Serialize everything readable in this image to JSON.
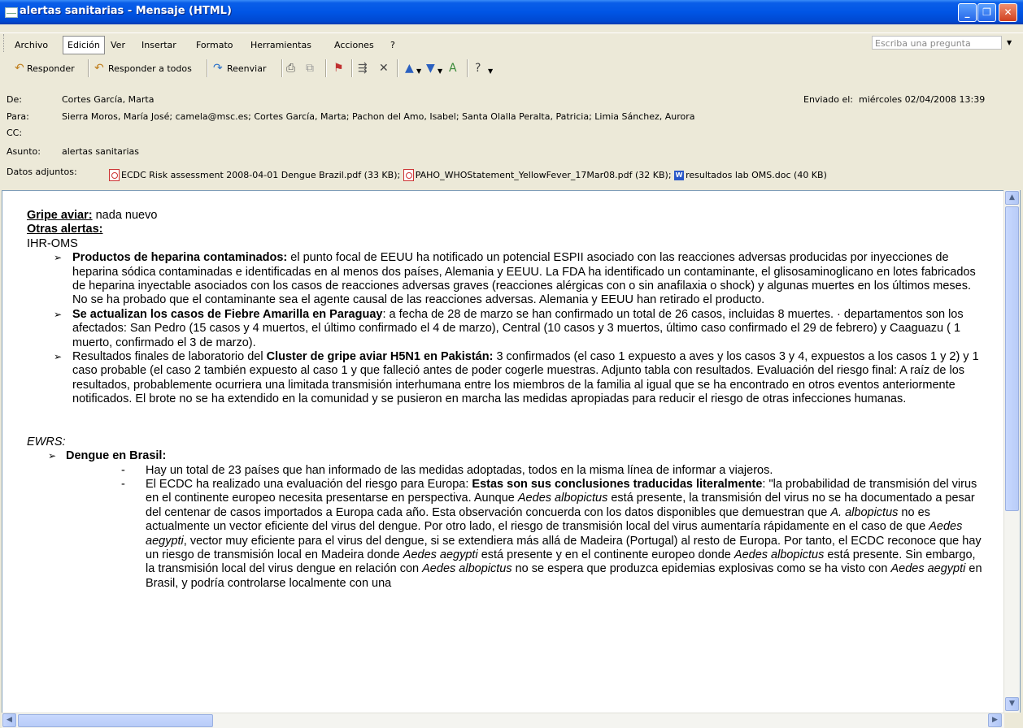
{
  "window": {
    "title": "alertas sanitarias - Mensaje (HTML)"
  },
  "menu": {
    "items": [
      "Archivo",
      "Edición",
      "Ver",
      "Insertar",
      "Formato",
      "Herramientas",
      "Acciones",
      "?"
    ],
    "active": "Edición",
    "ask_placeholder": "Escriba una pregunta"
  },
  "toolbar": {
    "reply": "Responder",
    "reply_all": "Responder a todos",
    "forward": "Reenviar"
  },
  "header": {
    "from_label": "De:",
    "from": "Cortes García, Marta",
    "to_label": "Para:",
    "to": "Sierra Moros, María José;  camela@msc.es; Cortes García, Marta; Pachon del Amo, Isabel; Santa Olalla Peralta, Patricia; Limia Sánchez, Aurora",
    "cc_label": "CC:",
    "subject_label": "Asunto:",
    "subject": "alertas sanitarias",
    "sent_label": "Enviado el:",
    "sent": "miércoles 02/04/2008 13:39",
    "attachments_label": "Datos adjuntos:",
    "attachments": [
      "ECDC Risk assessment 2008-04-01 Dengue Brazil.pdf (33 KB);",
      "PAHO_WHOStatement_YellowFever_17Mar08.pdf (32 KB);",
      "resultados lab OMS.doc (40 KB)"
    ]
  },
  "body": {
    "gripe_label": "Gripe aviar:",
    "gripe_text": " nada nuevo",
    "otras_label": "Otras alertas:",
    "ihr": "IHR-OMS",
    "b1_title": "Productos de heparina contaminados:",
    "b1_text": " el punto focal de EEUU ha notificado un potencial ESPII asociado con las reacciones adversas producidas por inyecciones de heparina sódica contaminadas e identificadas en al menos dos países, Alemania y EEUU. La FDA ha identificado un contaminante, el glisosaminoglicano en lotes fabricados de heparina inyectable asociados con los casos de reacciones adversas graves (reacciones alérgicas con o sin anafilaxia o shock) y algunas muertes en los últimos meses. No se ha probado que el contaminante sea el agente causal de las reacciones adversas. Alemania y EEUU han retirado el producto.",
    "b2_title": "Se actualizan los casos de Fiebre Amarilla en Paraguay",
    "b2_text": ": a fecha de 28 de marzo se han confirmado un total de 26 casos, incluidas 8 muertes. · departamentos son los afectados: San Pedro (15 casos y 4 muertos, el último confirmado el 4 de marzo), Central (10 casos y 3 muertos, último caso confirmado el 29 de febrero) y Caaguazu ( 1 muerto, confirmado el 3 de marzo).",
    "b3_pre": "Resultados finales de laboratorio del ",
    "b3_title": "Cluster de gripe aviar H5N1 en Pakistán:",
    "b3_text": " 3 confirmados (el caso 1 expuesto a aves y los casos 3 y 4, expuestos a los casos 1 y 2) y 1 caso probable (el caso 2 también expuesto al caso 1 y que falleció antes de poder cogerle muestras. Adjunto tabla con resultados. Evaluación del riesgo final: A raíz de los resultados, probablemente ocurriera una limitada transmisión interhumana entre los miembros de la familia al igual que se ha encontrado en otros eventos anteriormente notificados. El brote no se ha extendido en la comunidad y se pusieron en marcha las medidas apropiadas para reducir el riesgo de otras infecciones humanas.",
    "ewrs": "EWRS:",
    "dengue_title": "Dengue en Brasil:",
    "d1": "Hay un total de 23 países que han informado de las medidas adoptadas, todos en la misma línea de informar a viajeros.",
    "d2_pre": "El ECDC ha realizado una evaluación del riesgo para Europa: ",
    "d2_bold": "Estas son sus conclusiones traducidas literalmente",
    "d2_a": ": \"la probabilidad de transmisión del virus en el continente europeo necesita presentarse en perspectiva. Aunque ",
    "d2_i1": "Aedes albopictus",
    "d2_b": " está presente, la transmisión del virus no se ha documentado a pesar del centenar de casos importados a Europa cada año. Esta observación concuerda con los datos disponibles que demuestran que ",
    "d2_i2": "A. albopictus",
    "d2_c": " no es actualmente un vector eficiente del virus del dengue. Por otro lado, el riesgo de transmisión local del virus aumentaría rápidamente en el caso de que ",
    "d2_i3": "Aedes aegypti",
    "d2_d": ", vector muy eficiente para el virus del dengue, si se extendiera más allá de Madeira (Portugal) al resto de Europa. Por tanto, el ECDC reconoce que hay un riesgo de transmisión local en Madeira donde ",
    "d2_i4": "Aedes aegypti",
    "d2_e": " está presente y en el continente europeo donde ",
    "d2_i5": "Aedes albopictus",
    "d2_f": " está presente. Sin embargo, la transmisión local del virus dengue en relación con ",
    "d2_i6": "Aedes albopictus",
    "d2_g": " no se espera que produzca epidemias explosivas como se ha visto con ",
    "d2_i7": "Aedes aegypti",
    "d2_h": " en Brasil, y podría controlarse localmente con una"
  }
}
